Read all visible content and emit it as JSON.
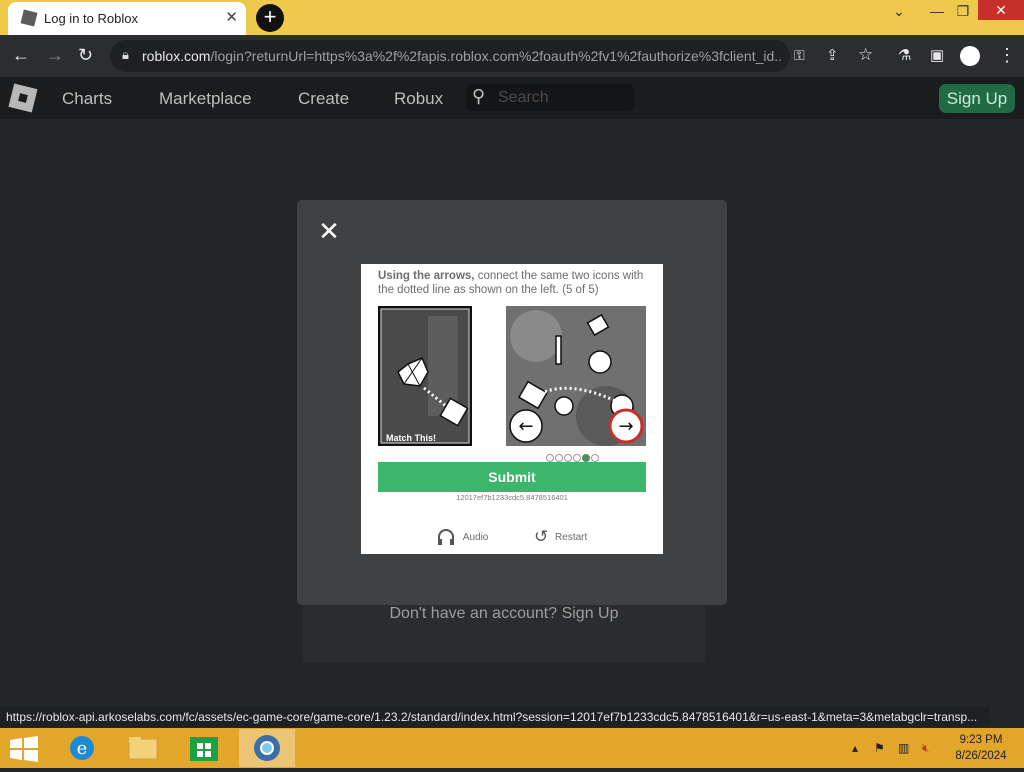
{
  "browser": {
    "tab_title": "Log in to Roblox",
    "new_tab_label": "+",
    "url_host": "roblox.com",
    "url_rest": "/login?returnUrl=https%3a%2f%2fapis.roblox.com%2foauth%2fv1%2fauthorize%3fclient_id...",
    "status_url": "https://roblox-api.arkoselabs.com/fc/assets/ec-game-core/game-core/1.23.2/standard/index.html?session=12017ef7b1233cdc5.8478516401&r=us-east-1&meta=3&metabgclr=transp..."
  },
  "site_nav": {
    "links": [
      "Charts",
      "Marketplace",
      "Create",
      "Robux"
    ],
    "search_placeholder": "Search",
    "signup_label": "Sign Up"
  },
  "page": {
    "no_account_text": "Don't have an account? Sign Up"
  },
  "captcha": {
    "instruction_bold": "Using the arrows,",
    "instruction_rest": " connect the same two icons with the dotted line as shown on the left. (5 of 5)",
    "match_label": "Match This!",
    "submit_label": "Submit",
    "session_id": "12017ef7b1233cdc5.8478516401",
    "audio_label": "Audio",
    "restart_label": "Restart",
    "pager_total": 6,
    "pager_active": 5,
    "left_arrow": "←",
    "right_arrow": "→"
  },
  "taskbar": {
    "time": "9:23 PM",
    "date": "8/26/2024"
  },
  "colors": {
    "accent_green": "#3cb66a",
    "signup_green": "#206a44",
    "tabstrip": "#efc94c",
    "taskbar": "#e2a62a"
  }
}
